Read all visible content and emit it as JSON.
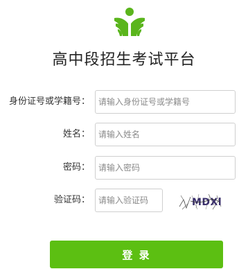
{
  "colors": {
    "brand_green": "#5cbf12",
    "logo_green": "#5ab51c"
  },
  "header": {
    "logo_icon": "sprout-logo-icon",
    "title": "高中段招生考试平台"
  },
  "form": {
    "id_field": {
      "label": "身份证号或学籍号：",
      "placeholder": "请输入身份证号或学籍号",
      "value": ""
    },
    "name_field": {
      "label": "姓名：",
      "placeholder": "请输入姓名",
      "value": ""
    },
    "password_field": {
      "label": "密码：",
      "placeholder": "请输入密码",
      "value": ""
    },
    "captcha_field": {
      "label": "验证码：",
      "placeholder": "请输入验证码",
      "value": "",
      "image_text": "MDXl"
    },
    "login_label": "登 录"
  }
}
